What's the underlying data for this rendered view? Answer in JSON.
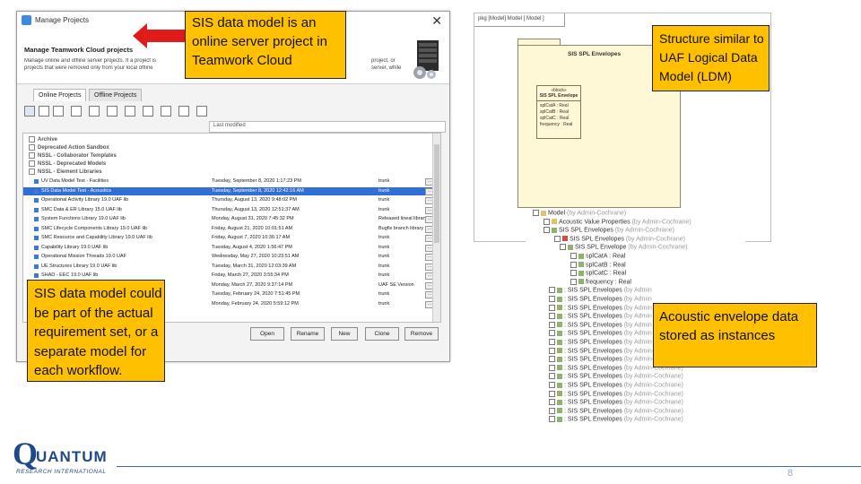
{
  "dialog": {
    "title": "Manage Projects",
    "heading": "Manage Teamwork Cloud projects",
    "desc_line1": "Manage online and offline server projects. If a project is",
    "desc_line2": "remove or open, and you can remove a selected server",
    "desc_line2b": "projects that were removed only from your local offline",
    "desc_right1": "project, or",
    "desc_right2": "server, while",
    "tabs": [
      "Online Projects",
      "Offline Projects"
    ],
    "filter_placeholder": "Last modified",
    "groups": [
      "Archive",
      "Deprecated Action Sandbox",
      "NSSL - Collaborator Templates",
      "NSSL - Deprecated Models",
      "NSSL - Element Libraries"
    ],
    "rows": [
      {
        "name": "UV Data Model Test - Facilities",
        "date": "Tuesday, September 8, 2020 1:17:23 PM",
        "branch": "trunk"
      },
      {
        "name": "SIS Data Model Test - Acoustics",
        "date": "Tuesday, September 8, 2020 12:42:16 AM",
        "branch": "trunk"
      },
      {
        "name": "Operational Activity Library 19.0 UAF lib",
        "date": "Thursday, August 13, 2020 9:48:02 PM",
        "branch": "trunk"
      },
      {
        "name": "SMC Data & ER Library 15.0 UAF lib",
        "date": "Thursday, August 13, 2020 12:51:37 AM",
        "branch": "trunk"
      },
      {
        "name": "System Functions Library 19.0 UAF lib",
        "date": "Monday, August 31, 2020 7:45:32 PM",
        "branch": "Released lineal library"
      },
      {
        "name": "SMC Lifecycle Components Library 19.0 UAF lib",
        "date": "Friday, August 21, 2020 10:01:51 AM",
        "branch": "Bugfix branch library"
      },
      {
        "name": "SMC Resource and Capability Library 19.0 UAF lib",
        "date": "Friday, August 7, 2020 10:36:17 AM",
        "branch": "trunk"
      },
      {
        "name": "Capability Library 19.0 UAF lib",
        "date": "Tuesday, August 4, 2020 1:56:47 PM",
        "branch": "trunk"
      },
      {
        "name": "Operational Mission Threads 19.0 UAF",
        "date": "Wednesday, May 27, 2020 10:23:51 AM",
        "branch": "trunk"
      },
      {
        "name": "UE Structures Library 19.0 UAF lib",
        "date": "Tuesday, March 31, 2020 12:03:39 AM",
        "branch": "trunk"
      },
      {
        "name": "SHAD - EEC 19.0 UAF lib",
        "date": "Friday, March 27, 2020 3:55:34 PM",
        "branch": "trunk"
      },
      {
        "name": "Operational Library 19.0 UAF lib",
        "date": "Monday, March 27, 2020 9:37:14 PM",
        "branch": "UAF SE Version"
      },
      {
        "name": "SIS - EEV 19.0 UAF lib",
        "date": "Tuesday, February 24, 2020 7:51:45 PM",
        "branch": "trunk"
      },
      {
        "name": "UAF Library",
        "date": "Monday, February 24, 2020 5:59:12 PM",
        "branch": "trunk"
      }
    ],
    "buttons": [
      "Open",
      "Rename",
      "New",
      "Clone",
      "Remove"
    ]
  },
  "callouts": {
    "top_center": [
      "SIS data model is an",
      "online server project in",
      "Teamwork Cloud"
    ],
    "left_bottom": [
      "SIS data model could",
      "be part of the actual",
      "requirement set, or a",
      "separate model for",
      "each workflow."
    ],
    "right_top": [
      "Structure similar to",
      "UAF Logical Data",
      "Model (LDM)"
    ],
    "right_middle": [
      "Acoustic envelope data",
      "stored as instances"
    ]
  },
  "diagram": {
    "tab_label": "pkg [Model] Model [  Model ]",
    "package_name": "SIS SPL Envelopes",
    "block_stereotype": "«block»",
    "block_name": "SIS SPL Envelope",
    "attributes": [
      "splCatA : Real",
      "splCatB : Real",
      "splCatC : Real",
      "frequency : Real"
    ]
  },
  "containment": {
    "rows": [
      {
        "text": "Model",
        "by": "(by Admin-Cochrane)"
      },
      {
        "text": "Acoustic Value Properties",
        "by": "(by Admin-Cochrane)"
      },
      {
        "text": "SIS SPL Envelopes",
        "by": "(by Admin-Cochrane)"
      },
      {
        "text": "SIS SPL Envelopes",
        "by": "(by Admin-Cochrane)"
      },
      {
        "text": "SIS SPL Envelope",
        "by": "(by Admin-Cochrane)"
      },
      {
        "text": "splCatA : Real",
        "by": ""
      },
      {
        "text": "splCatB : Real",
        "by": ""
      },
      {
        "text": "splCatC : Real",
        "by": ""
      },
      {
        "text": "frequency : Real",
        "by": ""
      },
      {
        "text": ": SIS SPL Envelopes",
        "by": "(by Admin"
      },
      {
        "text": ": SIS SPL Envelopes",
        "by": "(by Admin"
      },
      {
        "text": ": SIS SPL Envelopes",
        "by": "(by Admin"
      },
      {
        "text": ": SIS SPL Envelopes",
        "by": "(by Admin"
      },
      {
        "text": ": SIS SPL Envelopes",
        "by": "(by Admin"
      },
      {
        "text": ": SIS SPL Envelopes",
        "by": "(by Admin"
      },
      {
        "text": ": SIS SPL Envelopes",
        "by": "(by Admin"
      },
      {
        "text": ": SIS SPL Envelopes",
        "by": "(by Admin-Cochrane)"
      },
      {
        "text": ": SIS SPL Envelopes",
        "by": "(by Admin-Cochrane)"
      },
      {
        "text": ": SIS SPL Envelopes",
        "by": "(by Admin-Cochrane)"
      },
      {
        "text": ": SIS SPL Envelopes",
        "by": "(by Admin-Cochrane)"
      },
      {
        "text": ": SIS SPL Envelopes",
        "by": "(by Admin-Cochrane)"
      },
      {
        "text": ": SIS SPL Envelopes",
        "by": "(by Admin-Cochrane)"
      },
      {
        "text": ": SIS SPL Envelopes",
        "by": "(by Admin-Cochrane)"
      },
      {
        "text": ": SIS SPL Envelopes",
        "by": "(by Admin-Cochrane)"
      },
      {
        "text": ": SIS SPL Envelopes",
        "by": "(by Admin-Cochrane)"
      }
    ]
  },
  "logo": {
    "initial": "Q",
    "rest": "UANTUM",
    "sub": "RESEARCH INTERNATIONAL"
  },
  "page_number": "8",
  "colors": {
    "callout": "#ffc000",
    "selection": "#2f6fd6",
    "arrow": "#e01b1b",
    "brand": "#1f4a8a"
  }
}
